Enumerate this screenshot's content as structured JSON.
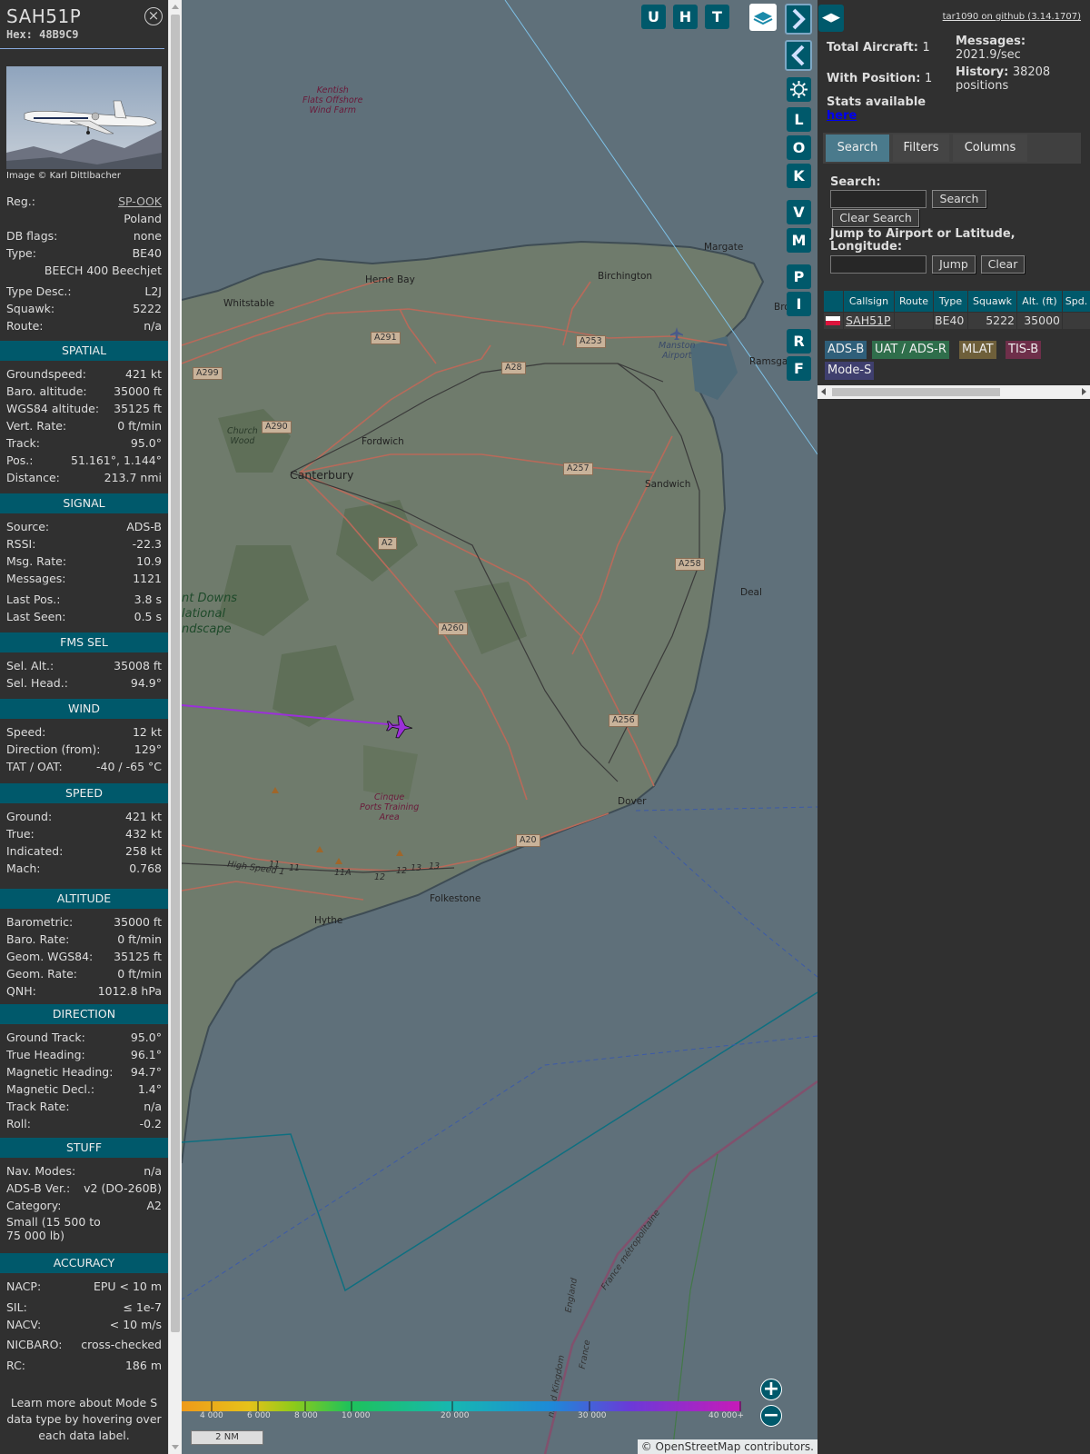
{
  "info": {
    "callsign": "SAH51P",
    "hex_label": "Hex:",
    "hex": "48B9C9",
    "photo_credit": "Image © Karl Dittlbacher",
    "basic": [
      {
        "k": "Reg.:",
        "v": "SP-OOK"
      },
      {
        "k": "",
        "v": "Poland"
      },
      {
        "k": "DB flags:",
        "v": "none"
      },
      {
        "k": "Type:",
        "v": "BE40"
      },
      {
        "k": "",
        "v": "BEECH 400 Beechjet"
      },
      {
        "k": "Type Desc.:",
        "v": "L2J"
      },
      {
        "k": "Squawk:",
        "v": "5222"
      },
      {
        "k": "Route:",
        "v": "n/a"
      }
    ],
    "sections": [
      {
        "title": "SPATIAL",
        "rows": [
          {
            "k": "Groundspeed:",
            "v": "421 kt"
          },
          {
            "k": "Baro. altitude:",
            "v": "35000 ft"
          },
          {
            "k": "WGS84 altitude:",
            "v": "35125 ft"
          },
          {
            "k": "Vert. Rate:",
            "v": "0 ft/min"
          },
          {
            "k": "Track:",
            "v": "95.0°"
          },
          {
            "k": "Pos.:",
            "v": "51.161°, 1.144°"
          },
          {
            "k": "Distance:",
            "v": "213.7 nmi"
          }
        ]
      },
      {
        "title": "SIGNAL",
        "rows": [
          {
            "k": "Source:",
            "v": "ADS-B"
          },
          {
            "k": "RSSI:",
            "v": "-22.3"
          },
          {
            "k": "Msg. Rate:",
            "v": "10.9"
          },
          {
            "k": "Messages:",
            "v": "1121"
          },
          {
            "k": "Last Pos.:",
            "v": "3.8 s"
          },
          {
            "k": "Last Seen:",
            "v": "0.5 s"
          }
        ]
      },
      {
        "title": "FMS SEL",
        "rows": [
          {
            "k": "Sel. Alt.:",
            "v": "35008 ft"
          },
          {
            "k": "Sel. Head.:",
            "v": "94.9°"
          }
        ]
      },
      {
        "title": "WIND",
        "rows": [
          {
            "k": "Speed:",
            "v": "12 kt"
          },
          {
            "k": "Direction (from):",
            "v": "129°"
          },
          {
            "k": "TAT / OAT:",
            "v": "-40 / -65 °C"
          }
        ]
      },
      {
        "title": "SPEED",
        "rows": [
          {
            "k": "Ground:",
            "v": "421 kt"
          },
          {
            "k": "True:",
            "v": "432 kt"
          },
          {
            "k": "Indicated:",
            "v": "258 kt"
          },
          {
            "k": "Mach:",
            "v": "0.768"
          }
        ]
      },
      {
        "title": "ALTITUDE",
        "rows": [
          {
            "k": "Barometric:",
            "v": "35000 ft"
          },
          {
            "k": "Baro. Rate:",
            "v": "0 ft/min"
          },
          {
            "k": "Geom. WGS84:",
            "v": "35125 ft"
          },
          {
            "k": "Geom. Rate:",
            "v": "0 ft/min"
          },
          {
            "k": "QNH:",
            "v": "1012.8 hPa"
          }
        ]
      },
      {
        "title": "DIRECTION",
        "rows": [
          {
            "k": "Ground Track:",
            "v": "95.0°"
          },
          {
            "k": "True Heading:",
            "v": "96.1°"
          },
          {
            "k": "Magnetic Heading:",
            "v": "94.7°"
          },
          {
            "k": "Magnetic Decl.:",
            "v": "1.4°"
          },
          {
            "k": "Track Rate:",
            "v": "n/a"
          },
          {
            "k": "Roll:",
            "v": "-0.2"
          }
        ]
      },
      {
        "title": "STUFF",
        "rows": [
          {
            "k": "Nav. Modes:",
            "v": "n/a"
          },
          {
            "k": "ADS-B Ver.:",
            "v": "v2 (DO-260B)"
          },
          {
            "k": "Category:",
            "v": "A2"
          },
          {
            "k": "Small (15 500 to 75 000 lb)",
            "v": ""
          }
        ]
      },
      {
        "title": "ACCURACY",
        "rows": [
          {
            "k": "NACP:",
            "v": "EPU < 10 m"
          },
          {
            "k": "SIL:",
            "v": "≤ 1e-7"
          },
          {
            "k": "NACV:",
            "v": "< 10 m/s"
          },
          {
            "k": "NICBARO:",
            "v": "cross-checked"
          },
          {
            "k": "RC:",
            "v": "186 m"
          }
        ]
      }
    ],
    "learn_more": "Learn more about Mode S data type by hovering over each data label."
  },
  "map": {
    "buttons": [
      "U",
      "H",
      "T"
    ],
    "side_buttons": [
      "L",
      "O",
      "K",
      "V",
      "M",
      "P",
      "I",
      "R",
      "F"
    ],
    "labels": {
      "margate": "Margate",
      "herne_bay": "Herne Bay",
      "birchington": "Birchington",
      "whitstable": "Whitstable",
      "ramsgate": "Ramsgat",
      "broadstairs": "Bro",
      "fordwich": "Fordwich",
      "canterbury": "Canterbury",
      "sandwich": "Sandwich",
      "deal": "Deal",
      "dover": "Dover",
      "folkestone": "Folkestone",
      "hythe": "Hythe",
      "church_wood": "Church\nWood",
      "kentish_flats": "Kentish\nFlats Offshore\nWind Farm",
      "manston": "Manston\nAirport",
      "cinque": "Cinque\nPorts Training\nArea",
      "north_downs": "nt Downs\nlational\nndscape",
      "high_speed": "High Speed 1",
      "england": "England",
      "france": "France",
      "united_kingdom": "nited Kingdom",
      "france_metro": "France métropolitaine"
    },
    "roads": [
      "A291",
      "A299",
      "A290",
      "A28",
      "A253",
      "A257",
      "A2",
      "A258",
      "A260",
      "A256",
      "A20"
    ],
    "junctions": [
      "11",
      "11",
      "11A",
      "12",
      "12",
      "13",
      "13"
    ],
    "legend_ticks": [
      "4 000",
      "6 000",
      "8 000",
      "10 000",
      "20 000",
      "30 000",
      "40 000+"
    ],
    "scale": "2 NM",
    "attribution_prefix": "©",
    "attribution_link": "OpenStreetMap",
    "attribution_suffix": "contributors."
  },
  "right": {
    "version": "tar1090 on github (3.14.1707)",
    "total_aircraft_label": "Total Aircraft:",
    "total_aircraft": "1",
    "with_position_label": "With Position:",
    "with_position": "1",
    "messages_label": "Messages:",
    "messages": "2021.9/sec",
    "history_label": "History:",
    "history": "38208 positions",
    "stats_label": "Stats available",
    "stats_link": "here",
    "tabs": [
      "Search",
      "Filters",
      "Columns"
    ],
    "search_label": "Search:",
    "search_button": "Search",
    "clear_search_button": "Clear Search",
    "jump_label": "Jump to Airport or Latitude, Longitude:",
    "jump_button": "Jump",
    "clear_button": "Clear",
    "table": {
      "columns": [
        "Callsign",
        "Route",
        "Type",
        "Squawk",
        "Alt. (ft)",
        "Spd."
      ],
      "rows": [
        {
          "callsign": "SAH51P",
          "route": "",
          "type": "BE40",
          "squawk": "5222",
          "alt": "35000",
          "spd": ""
        }
      ]
    },
    "sources": [
      {
        "label": "ADS-B",
        "color": "#2f5f7a"
      },
      {
        "label": "UAT / ADS-R",
        "color": "#2f6e4b"
      },
      {
        "label": "MLAT",
        "color": "#6e5f3a"
      },
      {
        "label": "TIS-B",
        "color": "#6e2f4a"
      },
      {
        "label": "Mode-S",
        "color": "#3f3f6e"
      }
    ]
  },
  "colors": {
    "accent": "#00596b",
    "aircraft": "#9b30d9",
    "map_sea": "#5f707a",
    "map_land": "#6e7a6d"
  }
}
